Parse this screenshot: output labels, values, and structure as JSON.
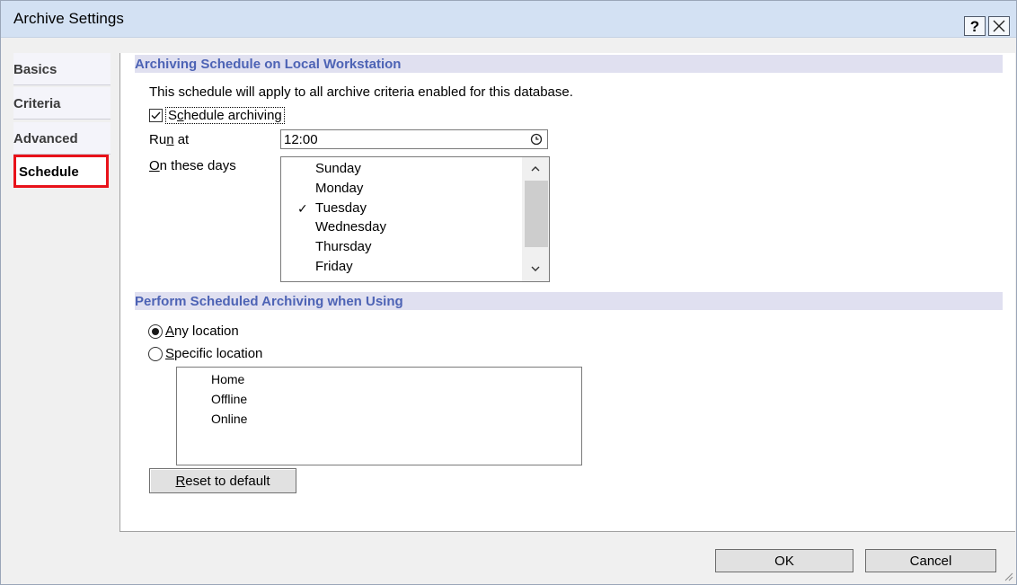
{
  "window": {
    "title": "Archive Settings",
    "help_label": "?",
    "close_icon": "close-icon"
  },
  "tabs": [
    {
      "label": "Basics",
      "active": false
    },
    {
      "label": "Criteria",
      "active": false
    },
    {
      "label": "Advanced",
      "active": false
    },
    {
      "label": "Schedule",
      "active": true
    }
  ],
  "schedule": {
    "header": "Archiving Schedule on Local Workstation",
    "description": "This schedule will apply to all archive criteria enabled for this database.",
    "schedule_archiving": {
      "pre": "S",
      "key": "c",
      "post": "hedule archiving",
      "checked": true
    },
    "run_at": {
      "pre": "Ru",
      "key": "n",
      "post": " at",
      "value": "12:00",
      "icon": "clock-icon"
    },
    "days_label": {
      "pre": "",
      "key": "O",
      "post": "n these days"
    },
    "days": [
      {
        "name": "Sunday",
        "checked": false
      },
      {
        "name": "Monday",
        "checked": false
      },
      {
        "name": "Tuesday",
        "checked": true
      },
      {
        "name": "Wednesday",
        "checked": false
      },
      {
        "name": "Thursday",
        "checked": false
      },
      {
        "name": "Friday",
        "checked": false
      }
    ],
    "check_mark": "✓"
  },
  "location": {
    "header": "Perform Scheduled Archiving when Using",
    "any": {
      "pre": "",
      "key": "A",
      "post": "ny location",
      "selected": true
    },
    "specific": {
      "pre": "",
      "key": "S",
      "post": "pecific location",
      "selected": false
    },
    "locations": [
      "Home",
      "Offline",
      "Online"
    ],
    "reset": {
      "pre": "",
      "key": "R",
      "post": "eset to default"
    }
  },
  "footer": {
    "ok_label": "OK",
    "cancel_label": "Cancel"
  },
  "colors": {
    "titlebar": "#d3e1f3",
    "section_header_bg": "#e0e0f0",
    "section_header_text": "#4d63b5",
    "highlight_box": "#e8121a"
  }
}
